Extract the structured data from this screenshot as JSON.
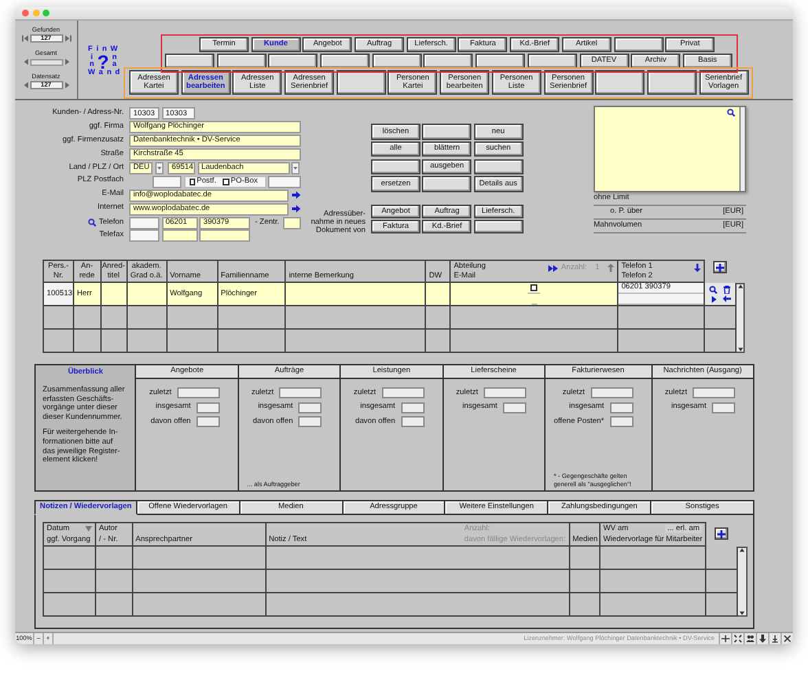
{
  "record_nav": {
    "found_label": "Gefunden",
    "found": "127",
    "total_label": "Gesamt",
    "record_label": "Datensatz",
    "record": "127"
  },
  "logo": {
    "top": "F i n W",
    "left": [
      "i",
      "n"
    ],
    "mark": "?",
    "right": [
      "n",
      "a"
    ],
    "bottom": "W a n d"
  },
  "module_tabs": {
    "rows": [
      [
        {
          "label": "Termin",
          "selected": false
        },
        {
          "label": "Kunde",
          "selected": true
        },
        {
          "label": "Angebot",
          "selected": false
        },
        {
          "label": "Auftrag",
          "selected": false
        },
        {
          "label": "Liefersch.",
          "selected": false
        },
        {
          "label": "Faktura",
          "selected": false
        },
        {
          "label": "Kd.-Brief",
          "selected": false
        },
        {
          "label": "Artikel",
          "selected": false
        },
        {
          "selected": false
        },
        {
          "label": "Privat",
          "selected": false
        }
      ],
      [
        {
          "selected": false
        },
        {
          "selected": false
        },
        {
          "selected": false
        },
        {
          "selected": false
        },
        {
          "selected": false
        },
        {
          "selected": false
        },
        {
          "selected": false
        },
        {
          "selected": false
        },
        {
          "label": "DATEV",
          "selected": false
        },
        {
          "label": "Archiv",
          "selected": false
        },
        {
          "label": "Basis",
          "selected": false
        }
      ]
    ],
    "sub_tabs": [
      {
        "label": "Adressen\nKartei",
        "selected": false
      },
      {
        "label": "Adressen\nbearbeiten",
        "selected": true
      },
      {
        "label": "Adressen\nListe",
        "selected": false
      },
      {
        "label": "Adressen\nSerienbrief",
        "selected": false
      },
      {
        "selected": false
      },
      {
        "label": "Personen\nKartei",
        "selected": false
      },
      {
        "label": "Personen\nbearbeiten",
        "selected": false
      },
      {
        "label": "Personen\nListe",
        "selected": false
      },
      {
        "label": "Personen\nSerienbrief",
        "selected": false
      },
      {
        "selected": false
      },
      {
        "selected": false
      },
      {
        "label": "Serienbrief\nVorlagen",
        "selected": false
      }
    ]
  },
  "annotations": [
    {
      "color": "#e0303a"
    },
    {
      "color": "#f0a040"
    }
  ],
  "address": [
    {
      "kind": "numbers",
      "label": "Kunden- / Adress-Nr.",
      "values": [
        "10303",
        "10303"
      ]
    },
    {
      "kind": "text",
      "label": "ggf. Firma",
      "value": "Wolfgang Plöchinger"
    },
    {
      "kind": "text",
      "label": "ggf. Firmenzusatz",
      "value": "Datenbanktechnik • DV-Service"
    },
    {
      "kind": "text",
      "label": "Straße",
      "value": "Kirchstraße 45"
    },
    {
      "kind": "location",
      "label": "Land / PLZ / Ort",
      "country": "DEU",
      "zip": "69514",
      "city": "Laudenbach"
    },
    {
      "kind": "postbox",
      "label": "PLZ Postfach",
      "options": [
        {
          "label": "Postf.",
          "checked": false
        },
        {
          "label": "PO-Box",
          "checked": false
        }
      ]
    },
    {
      "kind": "link",
      "label": "E-Mail",
      "value": "info@woplodabatec.de"
    },
    {
      "kind": "link",
      "label": "Internet",
      "value": "www.woplodabatec.de"
    },
    {
      "kind": "phone",
      "label": "Telefon",
      "lookup": true,
      "area": "06201",
      "number": "390379",
      "extension_label": "- Zentr."
    },
    {
      "kind": "phone",
      "label": "Telefax"
    }
  ],
  "actions": [
    {
      "kind": "labeled",
      "label": "löschen"
    },
    {
      "kind": "blank"
    },
    {
      "kind": "labeled",
      "label": "neu"
    },
    {
      "kind": "labeled",
      "label": "alle"
    },
    {
      "kind": "labeled",
      "label": "blättern"
    },
    {
      "kind": "labeled",
      "label": "suchen"
    },
    {
      "kind": "blank"
    },
    {
      "kind": "labeled",
      "label": "ausgeben"
    },
    {
      "kind": "blank"
    },
    {
      "kind": "labeled",
      "label": "ersetzen"
    },
    {
      "kind": "blank"
    },
    {
      "kind": "labeled",
      "label": "Details aus"
    }
  ],
  "transfer": {
    "label": "Adressüber-\nnahme in neues\nDokument von",
    "buttons": [
      {
        "kind": "labeled",
        "label": "Angebot"
      },
      {
        "kind": "labeled",
        "label": "Auftrag"
      },
      {
        "kind": "labeled",
        "label": "Liefersch."
      },
      {
        "kind": "labeled",
        "label": "Faktura"
      },
      {
        "kind": "labeled",
        "label": "Kd.-Brief"
      },
      {
        "kind": "blank"
      }
    ]
  },
  "credit": {
    "limit": "ohne Limit",
    "open_label": "o. P. über",
    "open_unit": "[EUR]",
    "dunning_label": "Mahnvolumen",
    "dunning_unit": "[EUR]"
  },
  "persons": {
    "columns": [
      "Pers.-\nNr.",
      "An-\nrede",
      "Anred-\ntitel",
      "akadem.\nGrad o.ä.",
      "Vorname",
      "Familienname",
      "interne Bemerkung",
      "DW",
      "Abteilung\nE-Mail",
      "Telefon 1\nTelefon 2"
    ],
    "count_label": "Anzahl:",
    "count": "1",
    "rows": [
      {
        "number": "100513",
        "salutation": "Herr",
        "first_name": "Wolfgang",
        "last_name": "Plöchinger",
        "checked": false,
        "phone_1": "06201 390379"
      }
    ]
  },
  "overview": {
    "title": "Überblick",
    "paragraphs": [
      "Zusammenfassung aller\nerfassten Geschäfts-\nvorgänge unter dieser\ndieser Kundennummer.",
      "Für weitergehende In-\nformationen bitte auf\ndas jeweilige Register-\nelement klicken!"
    ],
    "sections": [
      {
        "title": "Angebote",
        "rows": [
          "zuletzt",
          "insgesamt",
          "davon offen"
        ]
      },
      {
        "title": "Aufträge",
        "rows": [
          "zuletzt",
          "insgesamt",
          "davon offen"
        ],
        "note": "... als Auftraggeber"
      },
      {
        "title": "Leistungen",
        "rows": [
          "zuletzt",
          "insgesamt",
          "davon offen"
        ]
      },
      {
        "title": "Lieferscheine",
        "rows": [
          "zuletzt",
          "insgesamt"
        ]
      },
      {
        "title": "Fakturierwesen",
        "rows": [
          "zuletzt",
          "insgesamt",
          "offene Posten*"
        ],
        "note": "* - Gegengeschäfte gelten\ngenerell als \"ausgeglichen\"!"
      },
      {
        "title": "Nachrichten (Ausgang)",
        "rows": [
          "zuletzt",
          "insgesamt"
        ]
      }
    ]
  },
  "notes_tabs": [
    {
      "label": "Notizen / Wiedervorlagen",
      "selected": true
    },
    {
      "label": "Offene Wiedervorlagen",
      "selected": false
    },
    {
      "label": "Medien",
      "selected": false
    },
    {
      "label": "Adressgruppe",
      "selected": false
    },
    {
      "label": "Weitere Einstellungen",
      "selected": false
    },
    {
      "label": "Zahlungsbedingungen",
      "selected": false
    },
    {
      "label": "Sonstiges",
      "selected": false
    }
  ],
  "notes_table": {
    "columns": [
      {
        "top": "Datum",
        "bottom": "ggf. Vorgang",
        "filter": true
      },
      {
        "top": "Autor",
        "bottom": "/ - Nr."
      },
      {
        "bottom": "Ansprechpartner"
      },
      {
        "bottom": "Notiz / Text",
        "top_right": "Anzahl:",
        "bottom_right": "davon fällige Wiedervorlagen:"
      },
      {
        "bottom": "Medien"
      },
      {
        "top": "WV am",
        "top_right": "... erl. am",
        "bottom": "Wiedervorlage für Mitarbeiter"
      }
    ]
  },
  "status": {
    "zoom": "100%",
    "minus": "–",
    "plus": "+",
    "license": "Lizenznehmer: Wolfgang Plöchinger Datenbanktechnik • DV-Service"
  }
}
